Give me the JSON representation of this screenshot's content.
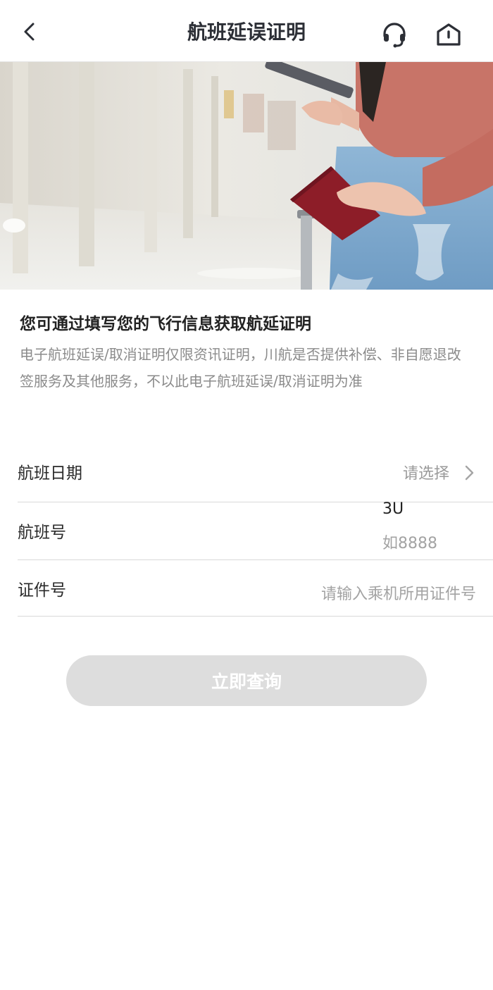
{
  "header": {
    "title": "航班延误证明"
  },
  "intro": {
    "title": "您可通过填写您的飞行信息获取航延证明",
    "description": "电子航班延误/取消证明仅限资讯证明，川航是否提供补偿、非自愿退改签服务及其他服务，不以此电子航班延误/取消证明为准"
  },
  "form": {
    "date": {
      "label": "航班日期",
      "placeholder": "请选择"
    },
    "flight": {
      "label": "航班号",
      "prefix": "3U",
      "placeholder": "如8888"
    },
    "id": {
      "label": "证件号",
      "placeholder": "请输入乘机所用证件号"
    }
  },
  "submit_label": "立即查询",
  "colors": {
    "title": "#2c2f36",
    "muted": "#8b8b8b",
    "button_disabled": "#dddddd"
  }
}
